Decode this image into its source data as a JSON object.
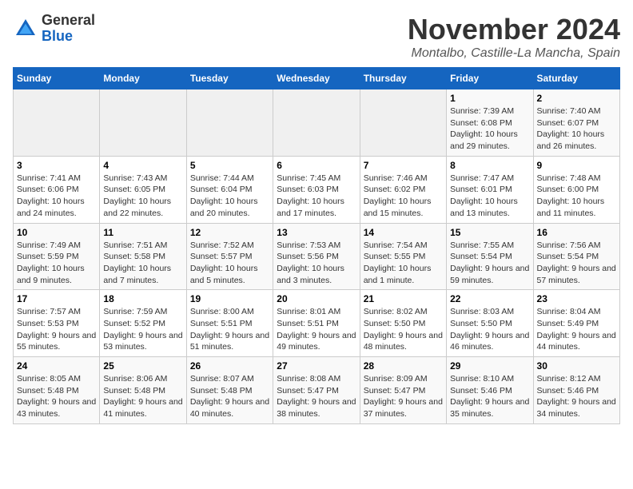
{
  "logo": {
    "general": "General",
    "blue": "Blue"
  },
  "title": "November 2024",
  "location": "Montalbo, Castille-La Mancha, Spain",
  "headers": [
    "Sunday",
    "Monday",
    "Tuesday",
    "Wednesday",
    "Thursday",
    "Friday",
    "Saturday"
  ],
  "weeks": [
    [
      {
        "day": "",
        "info": ""
      },
      {
        "day": "",
        "info": ""
      },
      {
        "day": "",
        "info": ""
      },
      {
        "day": "",
        "info": ""
      },
      {
        "day": "",
        "info": ""
      },
      {
        "day": "1",
        "info": "Sunrise: 7:39 AM\nSunset: 6:08 PM\nDaylight: 10 hours and 29 minutes."
      },
      {
        "day": "2",
        "info": "Sunrise: 7:40 AM\nSunset: 6:07 PM\nDaylight: 10 hours and 26 minutes."
      }
    ],
    [
      {
        "day": "3",
        "info": "Sunrise: 7:41 AM\nSunset: 6:06 PM\nDaylight: 10 hours and 24 minutes."
      },
      {
        "day": "4",
        "info": "Sunrise: 7:43 AM\nSunset: 6:05 PM\nDaylight: 10 hours and 22 minutes."
      },
      {
        "day": "5",
        "info": "Sunrise: 7:44 AM\nSunset: 6:04 PM\nDaylight: 10 hours and 20 minutes."
      },
      {
        "day": "6",
        "info": "Sunrise: 7:45 AM\nSunset: 6:03 PM\nDaylight: 10 hours and 17 minutes."
      },
      {
        "day": "7",
        "info": "Sunrise: 7:46 AM\nSunset: 6:02 PM\nDaylight: 10 hours and 15 minutes."
      },
      {
        "day": "8",
        "info": "Sunrise: 7:47 AM\nSunset: 6:01 PM\nDaylight: 10 hours and 13 minutes."
      },
      {
        "day": "9",
        "info": "Sunrise: 7:48 AM\nSunset: 6:00 PM\nDaylight: 10 hours and 11 minutes."
      }
    ],
    [
      {
        "day": "10",
        "info": "Sunrise: 7:49 AM\nSunset: 5:59 PM\nDaylight: 10 hours and 9 minutes."
      },
      {
        "day": "11",
        "info": "Sunrise: 7:51 AM\nSunset: 5:58 PM\nDaylight: 10 hours and 7 minutes."
      },
      {
        "day": "12",
        "info": "Sunrise: 7:52 AM\nSunset: 5:57 PM\nDaylight: 10 hours and 5 minutes."
      },
      {
        "day": "13",
        "info": "Sunrise: 7:53 AM\nSunset: 5:56 PM\nDaylight: 10 hours and 3 minutes."
      },
      {
        "day": "14",
        "info": "Sunrise: 7:54 AM\nSunset: 5:55 PM\nDaylight: 10 hours and 1 minute."
      },
      {
        "day": "15",
        "info": "Sunrise: 7:55 AM\nSunset: 5:54 PM\nDaylight: 9 hours and 59 minutes."
      },
      {
        "day": "16",
        "info": "Sunrise: 7:56 AM\nSunset: 5:54 PM\nDaylight: 9 hours and 57 minutes."
      }
    ],
    [
      {
        "day": "17",
        "info": "Sunrise: 7:57 AM\nSunset: 5:53 PM\nDaylight: 9 hours and 55 minutes."
      },
      {
        "day": "18",
        "info": "Sunrise: 7:59 AM\nSunset: 5:52 PM\nDaylight: 9 hours and 53 minutes."
      },
      {
        "day": "19",
        "info": "Sunrise: 8:00 AM\nSunset: 5:51 PM\nDaylight: 9 hours and 51 minutes."
      },
      {
        "day": "20",
        "info": "Sunrise: 8:01 AM\nSunset: 5:51 PM\nDaylight: 9 hours and 49 minutes."
      },
      {
        "day": "21",
        "info": "Sunrise: 8:02 AM\nSunset: 5:50 PM\nDaylight: 9 hours and 48 minutes."
      },
      {
        "day": "22",
        "info": "Sunrise: 8:03 AM\nSunset: 5:50 PM\nDaylight: 9 hours and 46 minutes."
      },
      {
        "day": "23",
        "info": "Sunrise: 8:04 AM\nSunset: 5:49 PM\nDaylight: 9 hours and 44 minutes."
      }
    ],
    [
      {
        "day": "24",
        "info": "Sunrise: 8:05 AM\nSunset: 5:48 PM\nDaylight: 9 hours and 43 minutes."
      },
      {
        "day": "25",
        "info": "Sunrise: 8:06 AM\nSunset: 5:48 PM\nDaylight: 9 hours and 41 minutes."
      },
      {
        "day": "26",
        "info": "Sunrise: 8:07 AM\nSunset: 5:48 PM\nDaylight: 9 hours and 40 minutes."
      },
      {
        "day": "27",
        "info": "Sunrise: 8:08 AM\nSunset: 5:47 PM\nDaylight: 9 hours and 38 minutes."
      },
      {
        "day": "28",
        "info": "Sunrise: 8:09 AM\nSunset: 5:47 PM\nDaylight: 9 hours and 37 minutes."
      },
      {
        "day": "29",
        "info": "Sunrise: 8:10 AM\nSunset: 5:46 PM\nDaylight: 9 hours and 35 minutes."
      },
      {
        "day": "30",
        "info": "Sunrise: 8:12 AM\nSunset: 5:46 PM\nDaylight: 9 hours and 34 minutes."
      }
    ]
  ]
}
